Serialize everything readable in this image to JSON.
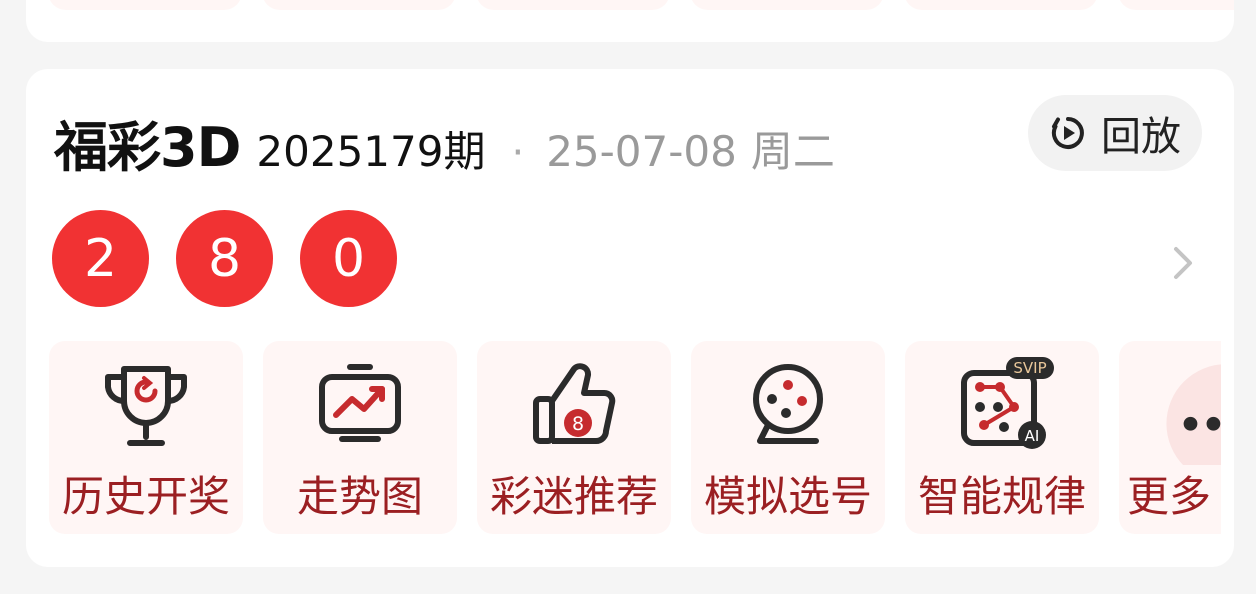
{
  "header": {
    "lottery_name": "福彩3D",
    "issue": "2025179期",
    "separator": "·",
    "date": "25-07-08",
    "weekday": "周二",
    "replay_label": "回放"
  },
  "result": {
    "balls": [
      "2",
      "8",
      "0"
    ],
    "ball_color": "#f13233"
  },
  "actions": [
    {
      "label": "历史开奖",
      "icon": "trophy-icon"
    },
    {
      "label": "走势图",
      "icon": "trend-chart-icon"
    },
    {
      "label": "彩迷推荐",
      "icon": "thumbs-up-icon",
      "badge": "8"
    },
    {
      "label": "模拟选号",
      "icon": "lottery-ball-icon"
    },
    {
      "label": "智能规律",
      "icon": "dice-pattern-icon",
      "badge_top": "SVIP",
      "badge_corner": "AI"
    },
    {
      "label": "更多",
      "icon": "more-icon"
    }
  ],
  "colors": {
    "accent": "#f13233",
    "label": "#9b1f22",
    "tile_bg": "#fff6f5"
  }
}
